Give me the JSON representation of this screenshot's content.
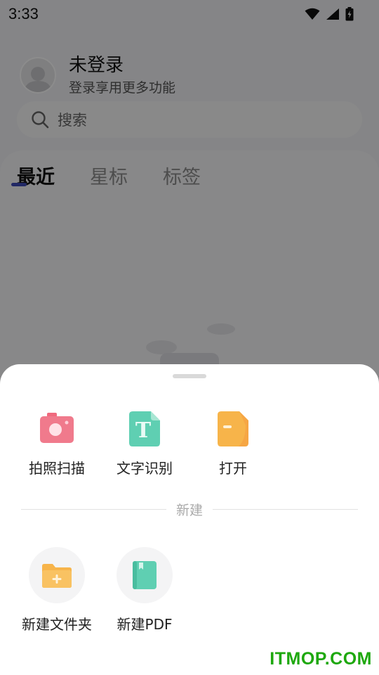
{
  "status_bar": {
    "time": "3:33"
  },
  "profile": {
    "name": "未登录",
    "subtitle": "登录享用更多功能"
  },
  "search": {
    "placeholder": "搜索"
  },
  "tabs": [
    {
      "label": "最近",
      "active": true
    },
    {
      "label": "星标",
      "active": false
    },
    {
      "label": "标签",
      "active": false
    }
  ],
  "sheet": {
    "actions": [
      {
        "label": "拍照扫描",
        "icon": "camera-icon",
        "color": "#ef6b80"
      },
      {
        "label": "文字识别",
        "icon": "text-recognition-icon",
        "color": "#5ccfb2"
      },
      {
        "label": "打开",
        "icon": "open-file-icon",
        "color": "#f7b24a"
      }
    ],
    "section_label": "新建",
    "create": [
      {
        "label": "新建文件夹",
        "icon": "new-folder-icon",
        "color": "#f7b24a"
      },
      {
        "label": "新建PDF",
        "icon": "new-pdf-icon",
        "color": "#5ccfb2"
      }
    ]
  },
  "watermark": "ITMOP.COM"
}
